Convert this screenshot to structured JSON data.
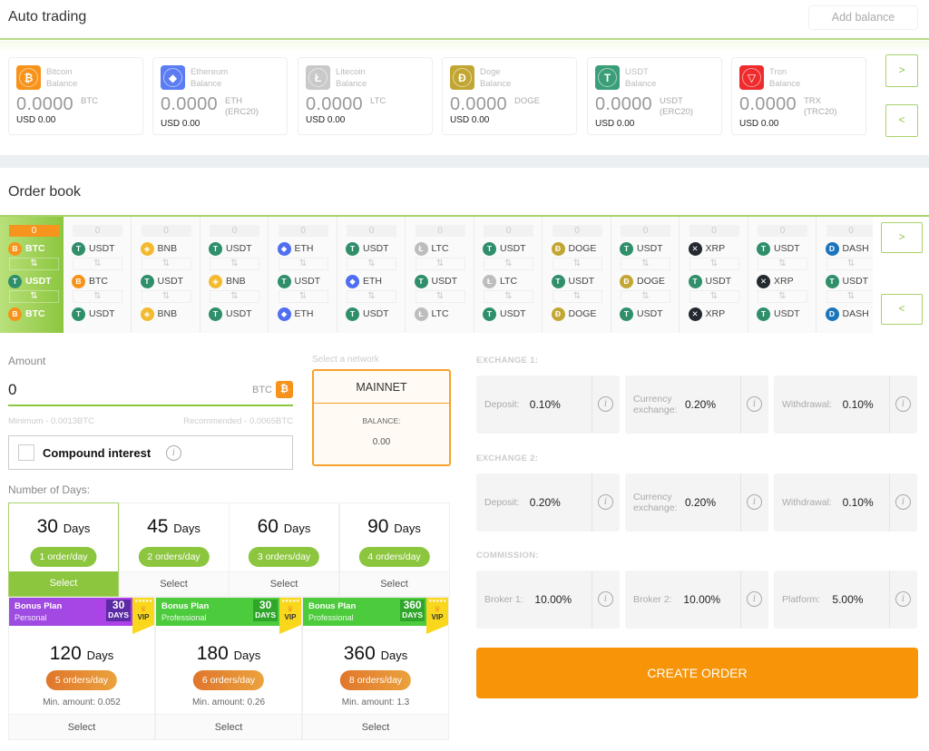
{
  "auto_trading": {
    "title": "Auto trading",
    "add_balance_label": "Add balance",
    "next_label": ">",
    "prev_label": "<",
    "balances": [
      {
        "name": "Bitcoin",
        "sub": "Balance",
        "amount": "0.0000",
        "unit": "BTC",
        "unit2": "",
        "usd": "USD 0.00",
        "icon": "bitcoin-icon",
        "glyph": "₿",
        "color": "#f7931a"
      },
      {
        "name": "Ethereum",
        "sub": "Balance",
        "amount": "0.0000",
        "unit": "ETH",
        "unit2": "(ERC20)",
        "usd": "USD 0.00",
        "icon": "ethereum-icon",
        "glyph": "◆",
        "color": "#5b7cf2"
      },
      {
        "name": "Litecoin",
        "sub": "Balance",
        "amount": "0.0000",
        "unit": "LTC",
        "unit2": "",
        "usd": "USD 0.00",
        "icon": "litecoin-icon",
        "glyph": "Ł",
        "color": "#c9c9c9"
      },
      {
        "name": "Doge",
        "sub": "Balance",
        "amount": "0.0000",
        "unit": "DOGE",
        "unit2": "",
        "usd": "USD 0.00",
        "icon": "doge-icon",
        "glyph": "Ð",
        "color": "#c2a633"
      },
      {
        "name": "USDT",
        "sub": "Balance",
        "amount": "0.0000",
        "unit": "USDT",
        "unit2": "(ERC20)",
        "usd": "USD 0.00",
        "icon": "tether-icon",
        "glyph": "T",
        "color": "#3a9e78"
      },
      {
        "name": "Tron",
        "sub": "Balance",
        "amount": "0.0000",
        "unit": "TRX",
        "unit2": "(TRC20)",
        "usd": "USD 0.00",
        "icon": "tron-icon",
        "glyph": "▽",
        "color": "#ef2b2d"
      }
    ]
  },
  "order_book": {
    "title": "Order book",
    "next_label": ">",
    "prev_label": "<",
    "swap_glyph": "⇅",
    "pairs": [
      {
        "count": "0",
        "coins": [
          "BTC",
          "USDT",
          "BTC"
        ],
        "active": true
      },
      {
        "count": "0",
        "coins": [
          "USDT",
          "BTC",
          "USDT"
        ]
      },
      {
        "count": "0",
        "coins": [
          "BNB",
          "USDT",
          "BNB"
        ]
      },
      {
        "count": "0",
        "coins": [
          "USDT",
          "BNB",
          "USDT"
        ]
      },
      {
        "count": "0",
        "coins": [
          "ETH",
          "USDT",
          "ETH"
        ]
      },
      {
        "count": "0",
        "coins": [
          "USDT",
          "ETH",
          "USDT"
        ]
      },
      {
        "count": "0",
        "coins": [
          "LTC",
          "USDT",
          "LTC"
        ]
      },
      {
        "count": "0",
        "coins": [
          "USDT",
          "LTC",
          "USDT"
        ]
      },
      {
        "count": "0",
        "coins": [
          "DOGE",
          "USDT",
          "DOGE"
        ]
      },
      {
        "count": "0",
        "coins": [
          "USDT",
          "DOGE",
          "USDT"
        ]
      },
      {
        "count": "0",
        "coins": [
          "XRP",
          "USDT",
          "XRP"
        ]
      },
      {
        "count": "0",
        "coins": [
          "USDT",
          "XRP",
          "USDT"
        ]
      },
      {
        "count": "0",
        "coins": [
          "DASH",
          "USDT",
          "DASH"
        ]
      }
    ],
    "coin_styles": {
      "BTC": {
        "color": "#f7931a",
        "glyph": "B"
      },
      "USDT": {
        "color": "#2f8f6a",
        "glyph": "T"
      },
      "BNB": {
        "color": "#f3ba2f",
        "glyph": "◈"
      },
      "ETH": {
        "color": "#4f6ef2",
        "glyph": "◆"
      },
      "LTC": {
        "color": "#bdbdbd",
        "glyph": "Ł"
      },
      "DOGE": {
        "color": "#c2a633",
        "glyph": "Ð"
      },
      "XRP": {
        "color": "#23292f",
        "glyph": "✕"
      },
      "DASH": {
        "color": "#1c75bc",
        "glyph": "D"
      }
    }
  },
  "form": {
    "amount_label": "Amount",
    "amount_value": "0",
    "amount_unit": "BTC",
    "amount_coin_glyph": "₿",
    "minimum_hint": "Minimum - 0.0013BTC",
    "recommended_hint": "Recommended - 0.0065BTC",
    "compound_label": "Compound interest",
    "compound_checked": false,
    "info_glyph": "i",
    "network_label": "Select a network",
    "network_name": "MAINNET",
    "network_balance_label": "BALANCE:",
    "network_balance": "0.00",
    "days_label": "Number of Days:"
  },
  "plans": [
    {
      "days": "30",
      "unit": "Days",
      "orders": "1 order/day",
      "select": "Select",
      "selected": true
    },
    {
      "days": "45",
      "unit": "Days",
      "orders": "2 orders/day",
      "select": "Select"
    },
    {
      "days": "60",
      "unit": "Days",
      "orders": "3 orders/day",
      "select": "Select"
    },
    {
      "days": "90",
      "unit": "Days",
      "orders": "4 orders/day",
      "select": "Select"
    }
  ],
  "bonus_plans": [
    {
      "banner_title": "Bonus Plan",
      "banner_sub": "Personal",
      "banner_days": "30",
      "banner_days_unit": "DAYS",
      "badge": "VIP",
      "theme": "purple",
      "days": "120",
      "unit": "Days",
      "orders": "5 orders/day",
      "min_amount": "Min. amount: 0.052",
      "select": "Select"
    },
    {
      "banner_title": "Bonus Plan",
      "banner_sub": "Professional",
      "banner_days": "30",
      "banner_days_unit": "DAYS",
      "badge": "VIP",
      "theme": "green",
      "days": "180",
      "unit": "Days",
      "orders": "6 orders/day",
      "min_amount": "Min. amount: 0.26",
      "select": "Select"
    },
    {
      "banner_title": "Bonus Plan",
      "banner_sub": "Professional",
      "banner_days": "360",
      "banner_days_unit": "DAYS",
      "badge": "VIP",
      "theme": "green",
      "days": "360",
      "unit": "Days",
      "orders": "8 orders/day",
      "min_amount": "Min. amount: 1.3",
      "select": "Select"
    }
  ],
  "fees": {
    "groups": [
      {
        "label": "EXCHANGE 1:",
        "items": [
          {
            "label": "Deposit:",
            "value": "0.10%"
          },
          {
            "label": "Currency exchange:",
            "value": "0.20%"
          },
          {
            "label": "Withdrawal:",
            "value": "0.10%"
          }
        ]
      },
      {
        "label": "EXCHANGE 2:",
        "items": [
          {
            "label": "Deposit:",
            "value": "0.20%"
          },
          {
            "label": "Currency exchange:",
            "value": "0.20%"
          },
          {
            "label": "Withdrawal:",
            "value": "0.10%"
          }
        ]
      },
      {
        "label": "COMMISSION:",
        "items": [
          {
            "label": "Broker 1:",
            "value": "10.00%"
          },
          {
            "label": "Broker 2:",
            "value": "10.00%"
          },
          {
            "label": "Platform:",
            "value": "5.00%"
          }
        ]
      }
    ]
  },
  "create_order_label": "CREATE ORDER"
}
